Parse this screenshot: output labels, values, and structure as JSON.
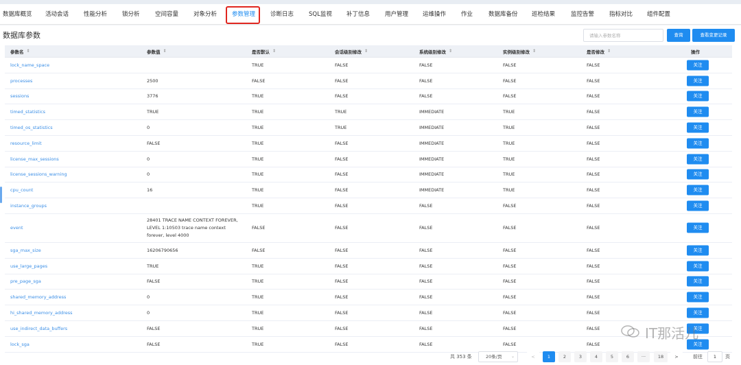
{
  "tabs": [
    {
      "label": "数据库概览"
    },
    {
      "label": "活动会话"
    },
    {
      "label": "性能分析"
    },
    {
      "label": "锁分析"
    },
    {
      "label": "空间容量"
    },
    {
      "label": "对象分析"
    },
    {
      "label": "参数管理"
    },
    {
      "label": "诊断日志"
    },
    {
      "label": "SQL监视"
    },
    {
      "label": "补丁信息"
    },
    {
      "label": "用户管理"
    },
    {
      "label": "运维操作"
    },
    {
      "label": "作业"
    },
    {
      "label": "数据库备份"
    },
    {
      "label": "巡检结果"
    },
    {
      "label": "监控告警"
    },
    {
      "label": "指标对比"
    },
    {
      "label": "组件配置"
    }
  ],
  "active_tab": "参数管理",
  "page": {
    "title": "数据库参数",
    "search_placeholder": "请输入参数名称",
    "search_button": "查询",
    "history_button": "查看变更记录"
  },
  "table": {
    "headers": [
      "参数名",
      "参数值",
      "是否默认",
      "会话级别修改",
      "系统级别修改",
      "实例级别修改",
      "是否修改",
      "操作"
    ],
    "action_label": "关注",
    "rows": [
      {
        "name": "lock_name_space",
        "value": "",
        "is_default": "TRUE",
        "session": "FALSE",
        "system": "FALSE",
        "instance": "FALSE",
        "modified": "FALSE"
      },
      {
        "name": "processes",
        "value": "2500",
        "is_default": "FALSE",
        "session": "FALSE",
        "system": "FALSE",
        "instance": "FALSE",
        "modified": "FALSE"
      },
      {
        "name": "sessions",
        "value": "3776",
        "is_default": "TRUE",
        "session": "FALSE",
        "system": "FALSE",
        "instance": "FALSE",
        "modified": "FALSE"
      },
      {
        "name": "timed_statistics",
        "value": "TRUE",
        "is_default": "TRUE",
        "session": "TRUE",
        "system": "IMMEDIATE",
        "instance": "TRUE",
        "modified": "FALSE"
      },
      {
        "name": "timed_os_statistics",
        "value": "0",
        "is_default": "TRUE",
        "session": "TRUE",
        "system": "IMMEDIATE",
        "instance": "TRUE",
        "modified": "FALSE"
      },
      {
        "name": "resource_limit",
        "value": "FALSE",
        "is_default": "TRUE",
        "session": "FALSE",
        "system": "IMMEDIATE",
        "instance": "TRUE",
        "modified": "FALSE"
      },
      {
        "name": "license_max_sessions",
        "value": "0",
        "is_default": "TRUE",
        "session": "FALSE",
        "system": "IMMEDIATE",
        "instance": "TRUE",
        "modified": "FALSE"
      },
      {
        "name": "license_sessions_warning",
        "value": "0",
        "is_default": "TRUE",
        "session": "FALSE",
        "system": "IMMEDIATE",
        "instance": "TRUE",
        "modified": "FALSE"
      },
      {
        "name": "cpu_count",
        "value": "16",
        "is_default": "TRUE",
        "session": "FALSE",
        "system": "IMMEDIATE",
        "instance": "TRUE",
        "modified": "FALSE"
      },
      {
        "name": "instance_groups",
        "value": "",
        "is_default": "TRUE",
        "session": "FALSE",
        "system": "FALSE",
        "instance": "FALSE",
        "modified": "FALSE"
      },
      {
        "name": "event",
        "value": "28401 TRACE NAME CONTEXT FOREVER, LEVEL 1:10503 trace name context forever, level 4000",
        "is_default": "FALSE",
        "session": "FALSE",
        "system": "FALSE",
        "instance": "FALSE",
        "modified": "FALSE",
        "multiline": true
      },
      {
        "name": "sga_max_size",
        "value": "16206790656",
        "is_default": "FALSE",
        "session": "FALSE",
        "system": "FALSE",
        "instance": "FALSE",
        "modified": "FALSE"
      },
      {
        "name": "use_large_pages",
        "value": "TRUE",
        "is_default": "TRUE",
        "session": "FALSE",
        "system": "FALSE",
        "instance": "FALSE",
        "modified": "FALSE"
      },
      {
        "name": "pre_page_sga",
        "value": "FALSE",
        "is_default": "TRUE",
        "session": "FALSE",
        "system": "FALSE",
        "instance": "FALSE",
        "modified": "FALSE"
      },
      {
        "name": "shared_memory_address",
        "value": "0",
        "is_default": "TRUE",
        "session": "FALSE",
        "system": "FALSE",
        "instance": "FALSE",
        "modified": "FALSE"
      },
      {
        "name": "hi_shared_memory_address",
        "value": "0",
        "is_default": "TRUE",
        "session": "FALSE",
        "system": "FALSE",
        "instance": "FALSE",
        "modified": "FALSE"
      },
      {
        "name": "use_indirect_data_buffers",
        "value": "FALSE",
        "is_default": "TRUE",
        "session": "FALSE",
        "system": "FALSE",
        "instance": "FALSE",
        "modified": "FALSE"
      },
      {
        "name": "lock_sga",
        "value": "FALSE",
        "is_default": "TRUE",
        "session": "FALSE",
        "system": "FALSE",
        "instance": "FALSE",
        "modified": "FALSE"
      }
    ]
  },
  "pagination": {
    "total_label": "共 353 条",
    "page_size": "20条/页",
    "prev": "<",
    "pages": [
      "1",
      "2",
      "3",
      "4",
      "5",
      "6",
      "···",
      "18"
    ],
    "current_page": "1",
    "next": ">",
    "goto_label": "前往",
    "goto_value": "1",
    "goto_suffix": "页"
  },
  "watermark": "IT那活儿",
  "colors": {
    "accent": "#1f8cf0",
    "link": "#3a8ee6",
    "highlight": "#e0261f"
  }
}
